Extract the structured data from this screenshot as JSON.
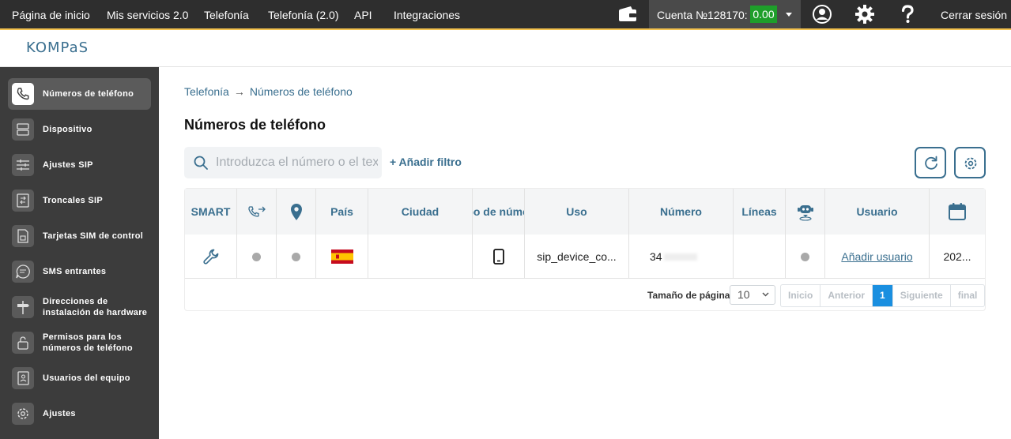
{
  "topnav": {
    "items": [
      "Página de inicio",
      "Mis servicios 2.0",
      "Telefonía",
      "Telefonía (2.0)",
      "API",
      "Integraciones"
    ],
    "account_label": "Cuenta №128170:",
    "balance": "0.00",
    "balance_color": "#1e9e2a",
    "logout": "Cerrar sesión",
    "icons": [
      "wallet-icon",
      "user-icon",
      "gear-icon",
      "help-icon"
    ]
  },
  "logo": "KOMPaS",
  "sidebar": {
    "items": [
      {
        "label": "Números de teléfono",
        "icon": "phone-icon",
        "active": true
      },
      {
        "label": "Dispositivo",
        "icon": "server-icon"
      },
      {
        "label": "Ajustes SIP",
        "icon": "sliders-icon"
      },
      {
        "label": "Troncales SIP",
        "icon": "trunk-icon"
      },
      {
        "label": "Tarjetas SIM de control",
        "icon": "sim-card-icon"
      },
      {
        "label": "SMS entrantes",
        "icon": "message-icon"
      },
      {
        "label": "Direcciones de instalación de hardware",
        "icon": "signpost-icon"
      },
      {
        "label": "Permisos para los números de teléfono",
        "icon": "lock-icon"
      },
      {
        "label": "Usuarios del equipo",
        "icon": "contacts-icon"
      },
      {
        "label": "Ajustes",
        "icon": "settings-icon"
      }
    ]
  },
  "main": {
    "breadcrumb": {
      "parent": "Telefonía",
      "current": "Números de teléfono"
    },
    "title": "Números de teléfono",
    "search_placeholder": "Introduzca el número o el texto",
    "add_filter": "+ Añadir filtro",
    "accent": "#3a6f8f"
  },
  "table": {
    "headers": [
      "SMART",
      "",
      "",
      "País",
      "Ciudad",
      "Tipo de número",
      "Uso",
      "Número",
      "Líneas",
      "",
      "Usuario",
      ""
    ],
    "header_icons": [
      "call-forward-icon",
      "location-icon",
      "robot-icon",
      "calendar-icon"
    ],
    "row": {
      "smart": "wrench-icon",
      "country": "Spain",
      "city": "",
      "type": "mobile-phone-icon",
      "use": "sip_device_co...",
      "number": "34",
      "lines": "",
      "user_link": "Añadir usuario",
      "date": "202..."
    }
  },
  "pagination": {
    "page_size_label": "Tamaño de página",
    "page_size": "10",
    "buttons": [
      "Inicio",
      "Anterior",
      "1",
      "Siguiente",
      "final"
    ],
    "active_color": "#1a8fe0"
  }
}
